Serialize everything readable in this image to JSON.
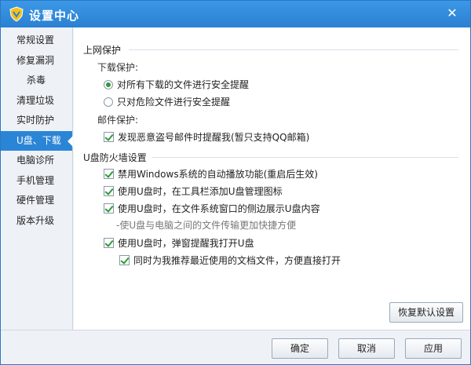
{
  "window": {
    "title": "设置中心",
    "close_glyph": "✕"
  },
  "sidebar": {
    "items": [
      {
        "label": "常规设置"
      },
      {
        "label": "修复漏洞"
      },
      {
        "label": "杀毒"
      },
      {
        "label": "清理垃圾"
      },
      {
        "label": "实时防护"
      },
      {
        "label": "U盘、下载"
      },
      {
        "label": "电脑诊所"
      },
      {
        "label": "手机管理"
      },
      {
        "label": "硬件管理"
      },
      {
        "label": "版本升级"
      }
    ],
    "active_index": 5
  },
  "web_protection": {
    "title": "上网保护",
    "download_label": "下载保护:",
    "download_options": [
      {
        "label": "对所有下载的文件进行安全提醒",
        "selected": true
      },
      {
        "label": "只对危险文件进行安全提醒",
        "selected": false
      }
    ],
    "mail_label": "邮件保护:",
    "mail_option": {
      "label": "发现恶意盗号邮件时提醒我(暂只支持QQ邮箱)",
      "checked": true
    }
  },
  "usb_firewall": {
    "title": "U盘防火墙设置",
    "options": [
      {
        "label": "禁用Windows系统的自动播放功能(重启后生效)",
        "checked": true
      },
      {
        "label": "使用U盘时，在工具栏添加U盘管理图标",
        "checked": true
      },
      {
        "label": "使用U盘时，在文件系统窗口的侧边展示U盘内容",
        "checked": true
      }
    ],
    "hint": "-使U盘与电脑之间的文件传输更加快捷方便",
    "popup_option": {
      "label": "使用U盘时，弹窗提醒我打开U盘",
      "checked": true
    },
    "popup_sub_option": {
      "label": "同时为我推荐最近使用的文档文件，方便直接打开",
      "checked": true
    }
  },
  "buttons": {
    "restore": "恢复默认设置",
    "ok": "确定",
    "cancel": "取消",
    "apply": "应用"
  },
  "colors": {
    "accent": "#2b85d6",
    "check_green": "#2e9b3a",
    "logo_yellow": "#f3c21a"
  }
}
